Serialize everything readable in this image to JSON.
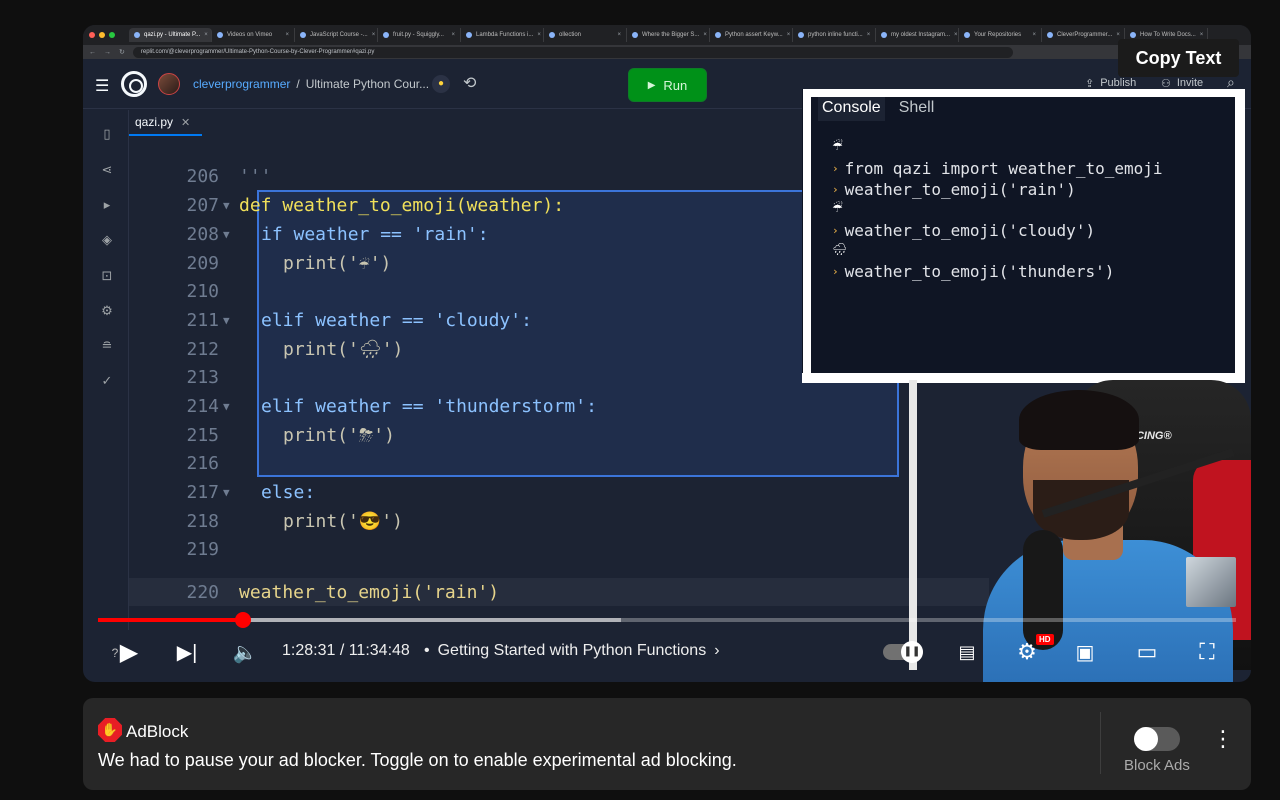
{
  "browser": {
    "tabs": [
      "qazi.py - Ultimate P...",
      "Videos on Vimeo",
      "JavaScript Course -...",
      "fruit.py - Squiggly...",
      "Lambda Functions i...",
      "ollection",
      "Where the Bigger S...",
      "Python assert Keyw...",
      "python inline functi...",
      "my oldest Instagram...",
      "Your Repositories",
      "CleverProgrammer...",
      "How To Write Docs..."
    ],
    "url": "replit.com/@cleverprogrammer/Ultimate-Python-Course-by-Clever-Programmer#qazi.py"
  },
  "replit": {
    "user": "cleverprogrammer",
    "separator": "/",
    "repl_name": "Ultimate Python Cour...",
    "run_label": "Run",
    "publish_label": "Publish",
    "invite_label": "Invite"
  },
  "editor": {
    "file_tab": "qazi.py",
    "lines": [
      {
        "num": "206",
        "text": "'''"
      },
      {
        "num": "207",
        "text": "def weather_to_emoji(weather):"
      },
      {
        "num": "208",
        "text": "if weather == 'rain':"
      },
      {
        "num": "209",
        "text": "print('☔')"
      },
      {
        "num": "210",
        "text": ""
      },
      {
        "num": "211",
        "text": "elif weather == 'cloudy':"
      },
      {
        "num": "212",
        "text": "print('🌧')"
      },
      {
        "num": "213",
        "text": ""
      },
      {
        "num": "214",
        "text": "elif weather == 'thunderstorm':"
      },
      {
        "num": "215",
        "text": "print('⛈')"
      },
      {
        "num": "216",
        "text": ""
      },
      {
        "num": "217",
        "text": "else:"
      },
      {
        "num": "218",
        "text": "print('😎')"
      },
      {
        "num": "219",
        "text": ""
      },
      {
        "num": "220",
        "text": "weather_to_emoji('rain')"
      }
    ]
  },
  "console": {
    "tabs": [
      "Console",
      "Shell"
    ],
    "active_tab": "Console",
    "entries": [
      {
        "type": "output",
        "text": "☔"
      },
      {
        "type": "input",
        "text": "from qazi import weather_to_emoji"
      },
      {
        "type": "input",
        "text": "weather_to_emoji('rain')"
      },
      {
        "type": "output",
        "text": "☔"
      },
      {
        "type": "input",
        "text": "weather_to_emoji('cloudy')"
      },
      {
        "type": "output",
        "text": "🌧"
      },
      {
        "type": "input",
        "text": "weather_to_emoji('thunders')"
      }
    ]
  },
  "overlay": {
    "copy_text_label": "Copy Text"
  },
  "player": {
    "current_time": "1:28:31",
    "duration": "11:34:48",
    "time_display": "1:28:31 / 11:34:48",
    "chapter_bullet": "•",
    "chapter_title": "Getting Started with Python Functions",
    "progress_fraction": 0.127,
    "quality_badge": "HD",
    "icons": [
      "play-icon",
      "next-icon",
      "volume-icon",
      "chevron-right-icon",
      "autoplay-toggle",
      "subtitles-icon",
      "settings-icon",
      "miniplayer-icon",
      "theater-icon",
      "fullscreen-icon"
    ],
    "webcam_chair_brand": "ACING®"
  },
  "adblock": {
    "brand": "AdBlock",
    "message": "We had to pause your ad blocker. Toggle on to enable experimental ad blocking.",
    "toggle_label": "Block Ads",
    "toggle_on": false
  },
  "colors": {
    "progress": "#ff0000",
    "replit_bg": "#1c2333",
    "run_green": "#009118",
    "adblock_red": "#e81e25"
  }
}
